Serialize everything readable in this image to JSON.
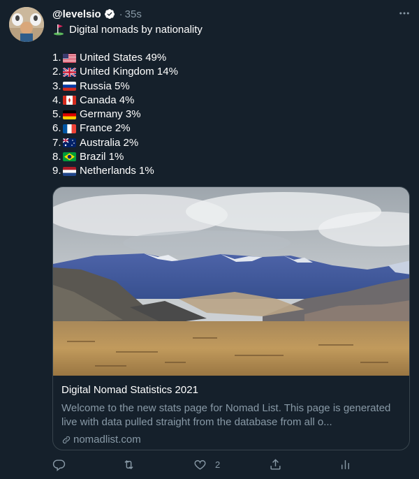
{
  "tweet": {
    "handle": "@levelsio",
    "separator": "·",
    "time": "35s",
    "subtitle_icon": "golf-flag-emoji",
    "subtitle": "Digital nomads by nationality",
    "list": [
      {
        "num": "1.",
        "flag": "us",
        "text": "United States 49%"
      },
      {
        "num": "2.",
        "flag": "uk",
        "text": "United Kingdom 14%"
      },
      {
        "num": "3.",
        "flag": "ru",
        "text": "Russia 5%"
      },
      {
        "num": "4.",
        "flag": "ca",
        "text": "Canada 4%"
      },
      {
        "num": "5.",
        "flag": "de",
        "text": "Germany 3%"
      },
      {
        "num": "6.",
        "flag": "fr",
        "text": "France 2%"
      },
      {
        "num": "7.",
        "flag": "au",
        "text": "Australia 2%"
      },
      {
        "num": "8.",
        "flag": "br",
        "text": "Brazil 1%"
      },
      {
        "num": "9.",
        "flag": "nl",
        "text": "Netherlands 1%"
      }
    ],
    "card": {
      "title": "Digital Nomad Statistics 2021",
      "description": "Welcome to the new stats page for Nomad List. This page is generated live with data pulled straight from the database from all o...",
      "link": "nomadlist.com",
      "link_icon": "link-icon"
    },
    "actions": {
      "reply_icon": "reply-icon",
      "retweet_icon": "retweet-icon",
      "like_icon": "heart-icon",
      "like_count": "2",
      "share_icon": "share-icon",
      "analytics_icon": "analytics-icon"
    }
  },
  "colors": {
    "background": "#15202b",
    "muted": "#8899a6",
    "border": "#38444d",
    "verified": "#ffffff"
  }
}
